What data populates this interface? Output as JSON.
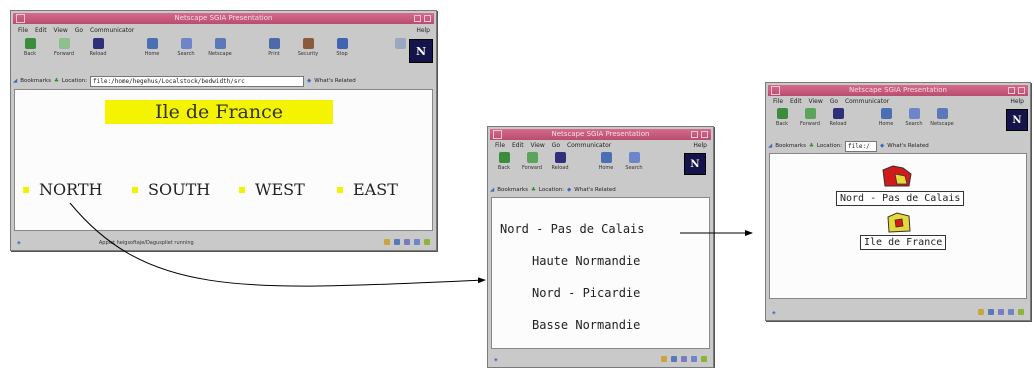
{
  "windows": [
    {
      "title": "Netscape SGIA Presentation",
      "menu": [
        "File",
        "Edit",
        "View",
        "Go",
        "Communicator"
      ],
      "help": "Help",
      "toolbar": [
        "Back",
        "Forward",
        "Reload",
        "Home",
        "Search",
        "Netscape",
        "Print",
        "Security",
        "Stop"
      ],
      "bookmarks": "Bookmarks",
      "location_label": "Location:",
      "location_value": "file:/home/hegehus/Localstock/bedwidth/src",
      "whats_related": "What's Related",
      "status_text": "Applet heigsoftaje/Daguspliet running"
    },
    {
      "title": "Netscape SGIA Presentation",
      "menu": [
        "File",
        "Edit",
        "View",
        "Go",
        "Communicator"
      ],
      "help": "Help",
      "toolbar": [
        "Back",
        "Forward",
        "Reload",
        "Home",
        "Search"
      ],
      "bookmarks": "Bookmarks",
      "location_label": "Location:",
      "whats_related": "What's Related"
    },
    {
      "title": "Netscape SGIA Presentation",
      "menu": [
        "File",
        "Edit",
        "View",
        "Go",
        "Communicator"
      ],
      "help": "Help",
      "toolbar": [
        "Back",
        "Forward",
        "Reload",
        "Home",
        "Search",
        "Netscape"
      ],
      "bookmarks": "Bookmarks",
      "location_label": "Location:",
      "location_value": "file:/",
      "whats_related": "What's Related"
    }
  ],
  "region_title": "Ile de France",
  "directions": [
    "NORTH",
    "SOUTH",
    "WEST",
    "EAST"
  ],
  "subregions": [
    "Nord - Pas de Calais",
    "Haute Normandie",
    "Nord - Picardie",
    "Basse Normandie"
  ],
  "map_labels": [
    "Nord - Pas de Calais",
    "Ile de France"
  ],
  "colors": {
    "title_bar": "#c45a7e",
    "chrome": "#c9c9c9",
    "highlight": "#f4f400",
    "map_red": "#d11a1a",
    "map_yellow": "#e7d83a"
  }
}
